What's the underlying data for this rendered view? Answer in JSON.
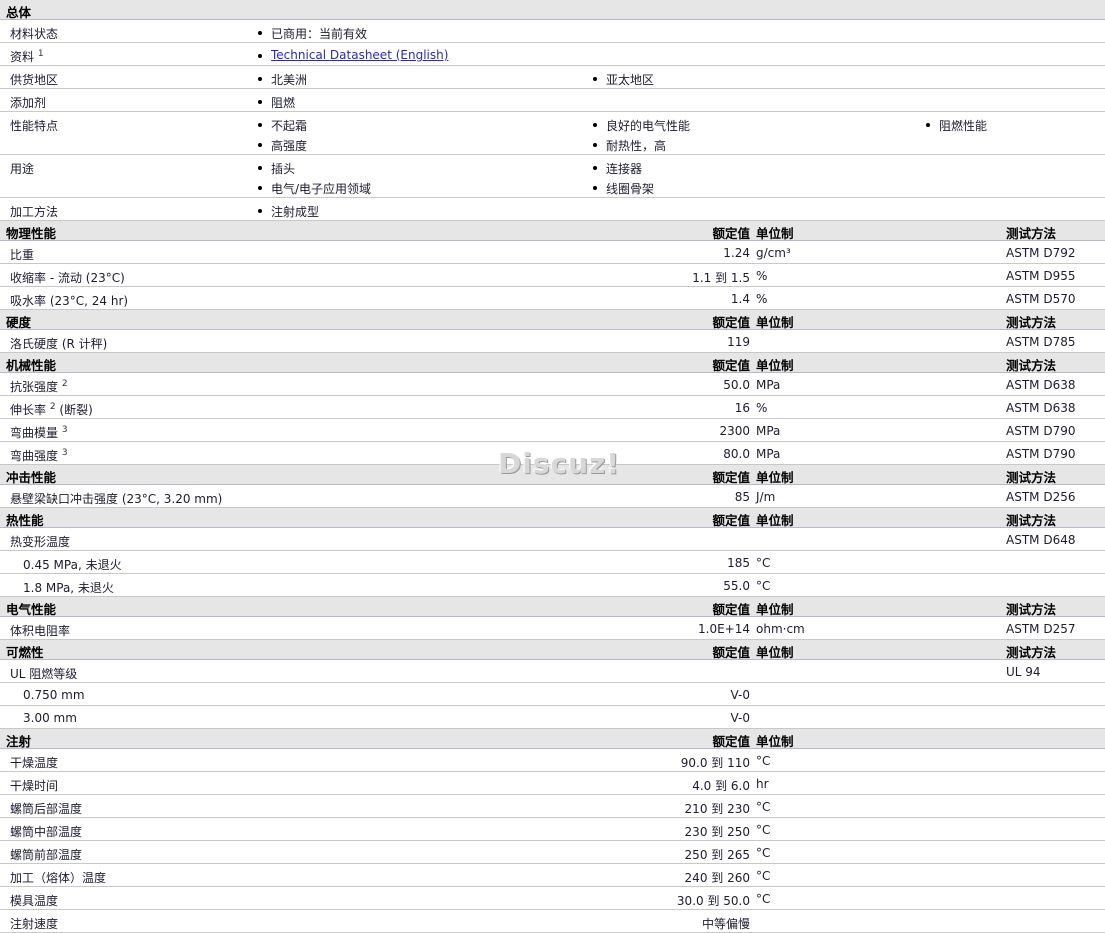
{
  "general": {
    "title": "总体",
    "rows": [
      {
        "name": "材料状态",
        "items": [
          [
            "已商用：当前有效"
          ]
        ]
      },
      {
        "name": "资料",
        "sup": "1",
        "link": "Technical Datasheet (English)"
      },
      {
        "name": "供货地区",
        "items": [
          [
            "北美洲"
          ],
          [
            "亚太地区"
          ]
        ]
      },
      {
        "name": "添加剂",
        "items": [
          [
            "阻燃"
          ]
        ]
      },
      {
        "name": "性能特点",
        "items": [
          [
            "不起霜",
            "高强度"
          ],
          [
            "良好的电气性能",
            "耐热性，高"
          ],
          [
            "阻燃性能"
          ]
        ]
      },
      {
        "name": "用途",
        "items": [
          [
            "插头",
            "电气/电子应用领域"
          ],
          [
            "连接器",
            "线圈骨架"
          ]
        ]
      },
      {
        "name": "加工方法",
        "items": [
          [
            "注射成型"
          ]
        ]
      }
    ]
  },
  "headers": {
    "value": "额定值",
    "unit": "单位制",
    "method": "测试方法"
  },
  "sections": [
    {
      "title": "物理性能",
      "method_header": true,
      "rows": [
        {
          "name": "比重",
          "value": "1.24",
          "unit": "g/cm³",
          "method": "ASTM D792"
        },
        {
          "name": "收缩率 - 流动 (23°C)",
          "value": "1.1 到  1.5",
          "unit": "%",
          "method": "ASTM D955"
        },
        {
          "name": "吸水率 (23°C, 24 hr)",
          "value": "1.4",
          "unit": "%",
          "method": "ASTM D570"
        }
      ]
    },
    {
      "title": "硬度",
      "method_header": true,
      "rows": [
        {
          "name": "洛氏硬度 (R 计秤)",
          "value": "119",
          "unit": "",
          "method": "ASTM D785"
        }
      ]
    },
    {
      "title": "机械性能",
      "method_header": true,
      "rows": [
        {
          "name": "抗张强度",
          "sup": "2",
          "value": "50.0",
          "unit": "MPa",
          "method": "ASTM D638"
        },
        {
          "name": "伸长率",
          "sup": "2",
          "suffix": " (断裂)",
          "value": "16",
          "unit": "%",
          "method": "ASTM D638"
        },
        {
          "name": "弯曲模量",
          "sup": "3",
          "value": "2300",
          "unit": "MPa",
          "method": "ASTM D790"
        },
        {
          "name": "弯曲强度",
          "sup": "3",
          "value": "80.0",
          "unit": "MPa",
          "method": "ASTM D790"
        }
      ]
    },
    {
      "title": "冲击性能",
      "method_header": true,
      "rows": [
        {
          "name": "悬壁梁缺口冲击强度 (23°C, 3.20 mm)",
          "value": "85",
          "unit": "J/m",
          "method": "ASTM D256"
        }
      ]
    },
    {
      "title": "热性能",
      "method_header": true,
      "rows": [
        {
          "name": "热变形温度",
          "value": "",
          "unit": "",
          "method": "ASTM D648"
        },
        {
          "name": "0.45 MPa, 未退火",
          "indent": true,
          "value": "185",
          "unit": "°C",
          "method": ""
        },
        {
          "name": "1.8 MPa, 未退火",
          "indent": true,
          "value": "55.0",
          "unit": "°C",
          "method": ""
        }
      ]
    },
    {
      "title": "电气性能",
      "method_header": true,
      "rows": [
        {
          "name": "体积电阻率",
          "value": "1.0E+14",
          "unit": "ohm·cm",
          "method": "ASTM D257"
        }
      ]
    },
    {
      "title": "可燃性",
      "method_header": true,
      "rows": [
        {
          "name": "UL 阻燃等级",
          "value": "",
          "unit": "",
          "method": "UL 94"
        },
        {
          "name": "0.750 mm",
          "indent": true,
          "value": "V-0",
          "unit": "",
          "method": ""
        },
        {
          "name": "3.00 mm",
          "indent": true,
          "value": "V-0",
          "unit": "",
          "method": ""
        }
      ]
    },
    {
      "title": "注射",
      "method_header": false,
      "rows": [
        {
          "name": "干燥温度",
          "value": "90.0 到  110",
          "unit": "°C",
          "method": ""
        },
        {
          "name": "干燥时间",
          "value": "4.0 到  6.0",
          "unit": "hr",
          "method": ""
        },
        {
          "name": "螺筒后部温度",
          "value": "210 到  230",
          "unit": "°C",
          "method": ""
        },
        {
          "name": "螺筒中部温度",
          "value": "230 到  250",
          "unit": "°C",
          "method": ""
        },
        {
          "name": "螺筒前部温度",
          "value": "250 到  265",
          "unit": "°C",
          "method": ""
        },
        {
          "name": "加工（熔体）温度",
          "value": "240 到  260",
          "unit": "°C",
          "method": ""
        },
        {
          "name": "模具温度",
          "value": "30.0 到  50.0",
          "unit": "°C",
          "method": ""
        },
        {
          "name": "注射速度",
          "value": "中等偏慢",
          "unit": "",
          "method": ""
        }
      ]
    }
  ],
  "watermark": "Discuz!"
}
